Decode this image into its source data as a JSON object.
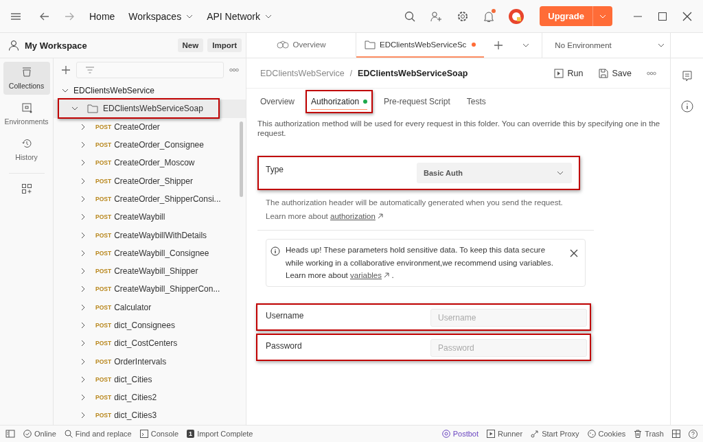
{
  "top_bar": {
    "nav": [
      {
        "label": "Home",
        "dropdown": false
      },
      {
        "label": "Workspaces",
        "dropdown": true
      },
      {
        "label": "API Network",
        "dropdown": true
      }
    ],
    "upgrade": "Upgrade",
    "notification": true
  },
  "workspace": {
    "title": "My Workspace",
    "buttons": [
      "New",
      "Import"
    ]
  },
  "left_nav": [
    {
      "label": "Collections",
      "selected": true
    },
    {
      "label": "Environments",
      "selected": false
    },
    {
      "label": "History",
      "selected": false
    }
  ],
  "tree": [
    {
      "name": "EDClientsWebService",
      "kind": "collection",
      "expanded": true,
      "children": [
        {
          "name": "EDClientsWebServiceSoap",
          "kind": "folder",
          "expanded": true,
          "highlighted": true,
          "children": [
            {
              "method": "POST",
              "name": "CreateOrder",
              "kind": "request"
            },
            {
              "method": "POST",
              "name": "CreateOrder_Consignee",
              "kind": "request"
            },
            {
              "method": "POST",
              "name": "CreateOrder_Moscow",
              "kind": "request"
            },
            {
              "method": "POST",
              "name": "CreateOrder_Shipper",
              "kind": "request"
            },
            {
              "method": "POST",
              "name": "CreateOrder_ShipperConsi...",
              "kind": "request"
            },
            {
              "method": "POST",
              "name": "CreateWaybill",
              "kind": "request"
            },
            {
              "method": "POST",
              "name": "CreateWaybillWithDetails",
              "kind": "request"
            },
            {
              "method": "POST",
              "name": "CreateWaybill_Consignee",
              "kind": "request"
            },
            {
              "method": "POST",
              "name": "CreateWaybill_Shipper",
              "kind": "request"
            },
            {
              "method": "POST",
              "name": "CreateWaybill_ShipperCon...",
              "kind": "request"
            },
            {
              "method": "POST",
              "name": "Calculator",
              "kind": "request"
            },
            {
              "method": "POST",
              "name": "dict_Consignees",
              "kind": "request"
            },
            {
              "method": "POST",
              "name": "dict_CostCenters",
              "kind": "request"
            },
            {
              "method": "POST",
              "name": "OrderIntervals",
              "kind": "request"
            },
            {
              "method": "POST",
              "name": "dict_Cities",
              "kind": "request"
            },
            {
              "method": "POST",
              "name": "dict_Cities2",
              "kind": "request"
            },
            {
              "method": "POST",
              "name": "dict_Cities3",
              "kind": "request"
            }
          ]
        }
      ]
    }
  ],
  "open_tabs": [
    {
      "label": "Overview",
      "kind": "overview",
      "selected": false,
      "unsaved": false
    },
    {
      "label": "EDClientsWebServiceSc",
      "kind": "folder",
      "selected": true,
      "unsaved": true
    }
  ],
  "environment": "No Environment",
  "breadcrumb": {
    "parent": "EDClientsWebService",
    "separator": "/",
    "current": "EDClientsWebServiceSoap"
  },
  "actions": [
    "Run",
    "Save"
  ],
  "content_tabs": [
    {
      "label": "Overview",
      "selected": false,
      "indicator": false,
      "highlighted": false
    },
    {
      "label": "Authorization",
      "selected": true,
      "indicator": true,
      "highlighted": true
    },
    {
      "label": "Pre-request Script",
      "selected": false,
      "indicator": false,
      "highlighted": false
    },
    {
      "label": "Tests",
      "selected": false,
      "indicator": false,
      "highlighted": false
    }
  ],
  "description": "This authorization method will be used for every request in this folder. You can override this by specifying one in the request.",
  "type": {
    "label": "Type",
    "value": "Basic Auth",
    "highlighted": true
  },
  "type_help": "The authorization header will be automatically generated when you send the request.",
  "type_learn": {
    "text": "Learn more about",
    "link": "authorization"
  },
  "alert": {
    "text": "Heads up! These parameters hold sensitive data. To keep this data secure while working in a collaborative environment,we recommend using variables.",
    "learn": "Learn more about",
    "link": "variables",
    "tail": "."
  },
  "fields": [
    {
      "label": "Username",
      "placeholder": "Username",
      "highlighted": true
    },
    {
      "label": "Password",
      "placeholder": "Password",
      "highlighted": true
    }
  ],
  "status_bar": {
    "left": [
      {
        "label": "Online"
      },
      {
        "label": "Find and replace"
      },
      {
        "label": "Console"
      },
      {
        "label": "Import Complete",
        "badge": "1"
      }
    ],
    "right": [
      {
        "label": "Postbot",
        "accent": true
      },
      {
        "label": "Runner",
        "accent": false
      },
      {
        "label": "Start Proxy",
        "accent": false
      },
      {
        "label": "Cookies",
        "accent": false
      },
      {
        "label": "Trash",
        "accent": false
      }
    ]
  }
}
